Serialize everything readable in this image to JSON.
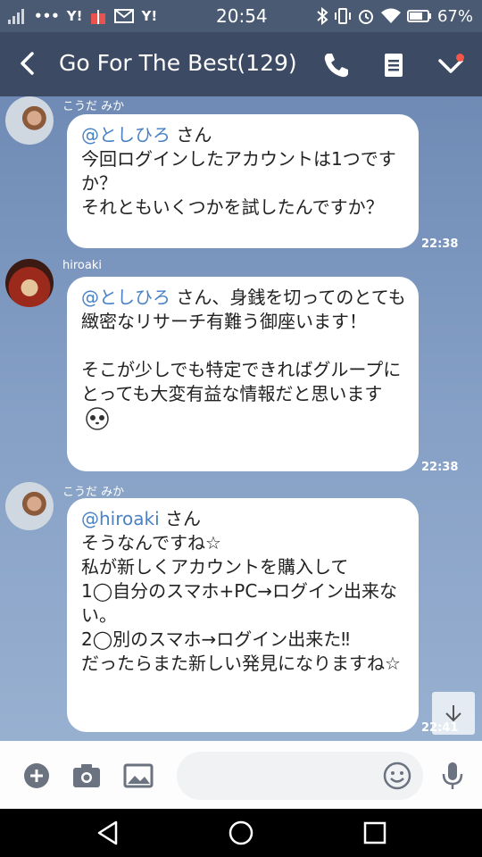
{
  "status_bar": {
    "time": "20:54",
    "battery": "67%",
    "icons": [
      "signal-icon",
      "more-icon",
      "yahoo-icon",
      "gift-icon",
      "mail-icon",
      "yahoo-icon",
      "bluetooth-icon",
      "vibrate-icon",
      "alarm-icon",
      "wifi-icon",
      "battery-icon"
    ]
  },
  "header": {
    "title": "Go For The Best(129)",
    "icons": [
      "back-icon",
      "phone-icon",
      "notes-icon",
      "chevron-down-icon"
    ]
  },
  "messages": [
    {
      "sender": "こうだ みか",
      "mention": "@としひろ",
      "text": " さん\n今回ログインしたアカウントは1つですか？\nそれともいくつかを試したんですか？",
      "time": "22:38"
    },
    {
      "sender": "hiroaki",
      "mention": "@としひろ",
      "text": " さん、身銭を切ってのとても緻密なリサーチ有難う御座います！\n\nそこが少しでも特定できればグループにとっても大変有益な情報だと思います",
      "time": "22:38"
    },
    {
      "sender": "こうだ みか",
      "mention": "@hiroaki",
      "text": " さん\nそうなんですね☆\n私が新しくアカウントを購入して\n1◯自分のスマホ+PC→ログイン出来ない。\n2◯別のスマホ→ログイン出来た‼\nだったらまた新しい発見になりますね☆",
      "time": "22:41"
    }
  ],
  "input_bar": {
    "placeholder": "",
    "icons": [
      "plus-icon",
      "camera-icon",
      "image-icon",
      "emoji-icon",
      "microphone-icon"
    ]
  },
  "nav_bar": {
    "icons": [
      "nav-back-icon",
      "nav-home-icon",
      "nav-recents-icon"
    ]
  },
  "colors": {
    "header": "#3c4a63",
    "status_bar": "#4a5a72",
    "mention": "#4a82c4",
    "notification_dot": "#f2574a"
  }
}
